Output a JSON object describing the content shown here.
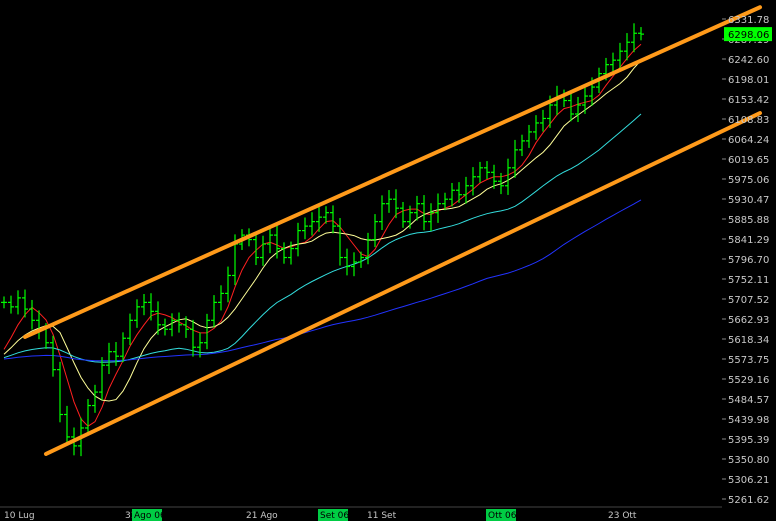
{
  "chart_data": {
    "type": "ohlc",
    "background": "#000000",
    "y_axis_side": "right",
    "y_ticks": [
      "6331.78",
      "6287.19",
      "6242.60",
      "6198.01",
      "6153.42",
      "6108.83",
      "6064.24",
      "6019.65",
      "5975.06",
      "5930.47",
      "5885.88",
      "5841.29",
      "5796.70",
      "5752.11",
      "5707.52",
      "5662.93",
      "5618.34",
      "5573.75",
      "5529.16",
      "5484.57",
      "5439.98",
      "5395.39",
      "5350.80",
      "5306.21",
      "5261.62"
    ],
    "ylim": [
      5261.62,
      6331.78
    ],
    "last_value": "6298.06",
    "last_value_color": "#00ff00",
    "x_labels": [
      "10 Lug",
      "31",
      "21 Ago",
      "11 Set",
      "23 Ott"
    ],
    "month_markers": [
      "Ago 06",
      "Set 06",
      "Ott 06"
    ],
    "n_bars": 92,
    "bar_color": "#00ff00",
    "closes": [
      5700,
      5690,
      5710,
      5685,
      5660,
      5640,
      5610,
      5550,
      5450,
      5400,
      5380,
      5420,
      5470,
      5500,
      5560,
      5590,
      5580,
      5620,
      5660,
      5690,
      5700,
      5680,
      5650,
      5640,
      5660,
      5650,
      5640,
      5600,
      5610,
      5660,
      5700,
      5720,
      5760,
      5830,
      5850,
      5840,
      5800,
      5830,
      5850,
      5820,
      5800,
      5820,
      5860,
      5870,
      5880,
      5890,
      5900,
      5870,
      5800,
      5780,
      5790,
      5800,
      5840,
      5880,
      5920,
      5930,
      5910,
      5880,
      5900,
      5920,
      5880,
      5900,
      5920,
      5930,
      5950,
      5940,
      5960,
      5980,
      6000,
      5990,
      5970,
      5960,
      6000,
      6040,
      6060,
      6080,
      6100,
      6110,
      6140,
      6160,
      6150,
      6120,
      6140,
      6160,
      6180,
      6210,
      6230,
      6240,
      6260,
      6280,
      6300,
      6298.06
    ],
    "series": [
      {
        "name": "",
        "color": "#ff2020",
        "period": 5
      },
      {
        "name": "",
        "color": "#ffff99",
        "period": 9
      },
      {
        "name": "",
        "color": "#33dddd",
        "period": 26
      },
      {
        "name": "",
        "color": "#2233ff",
        "period": 70
      }
    ],
    "channel": {
      "color": "#ff9a1a",
      "upper": {
        "from": {
          "bar": 3,
          "value": 5623
        },
        "to": {
          "bar": 108,
          "value": 6358
        }
      },
      "lower": {
        "from": {
          "bar": 6,
          "value": 5362
        },
        "to": {
          "bar": 108,
          "value": 6122
        }
      }
    }
  }
}
